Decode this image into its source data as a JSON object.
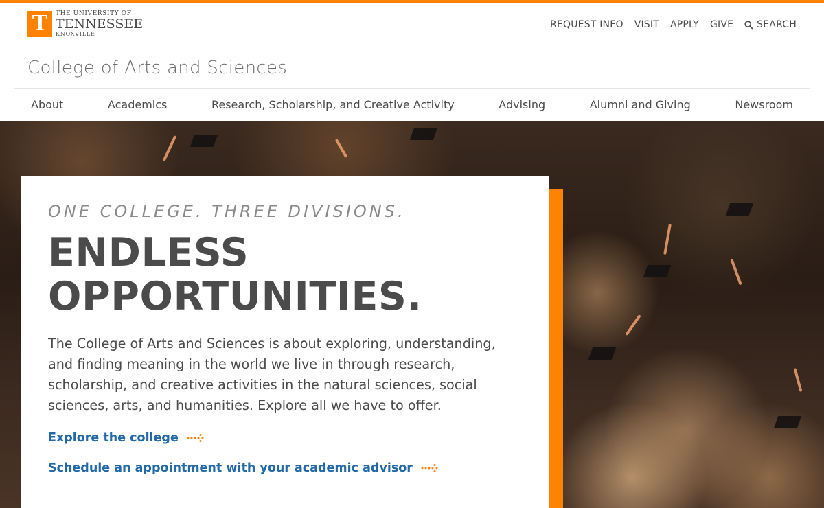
{
  "header": {
    "logo": {
      "letter": "T",
      "line1": "THE UNIVERSITY OF",
      "line2": "TENNESSEE",
      "line3": "KNOXVILLE"
    },
    "utility_nav": [
      {
        "label": "REQUEST INFO"
      },
      {
        "label": "VISIT"
      },
      {
        "label": "APPLY"
      },
      {
        "label": "GIVE"
      },
      {
        "label": "SEARCH",
        "icon": "search-icon"
      }
    ],
    "site_title": "College of Arts and Sciences"
  },
  "main_nav": [
    {
      "label": "About"
    },
    {
      "label": "Academics"
    },
    {
      "label": "Research, Scholarship, and Creative Activity"
    },
    {
      "label": "Advising"
    },
    {
      "label": "Alumni and Giving"
    },
    {
      "label": "Newsroom"
    }
  ],
  "hero": {
    "eyebrow": "ONE COLLEGE. THREE DIVISIONS.",
    "headline_line1": "ENDLESS",
    "headline_line2": "OPPORTUNITIES.",
    "body": "The College of Arts and Sciences is about exploring, understanding, and finding meaning in the world we live in through research, scholarship, and creative activities in the natural sciences, social sciences, arts, and humanities. Explore all we have to offer.",
    "links": [
      {
        "label": "Explore the college",
        "icon": "dotted-arrow-icon"
      },
      {
        "label": "Schedule an appointment with your academic advisor",
        "icon": "dotted-arrow-icon"
      }
    ],
    "image_subject": "graduates tossing caps in arena"
  },
  "colors": {
    "brand_orange": "#ff8200",
    "text_dark": "#4b4b4b",
    "link_blue": "#2269a8"
  }
}
